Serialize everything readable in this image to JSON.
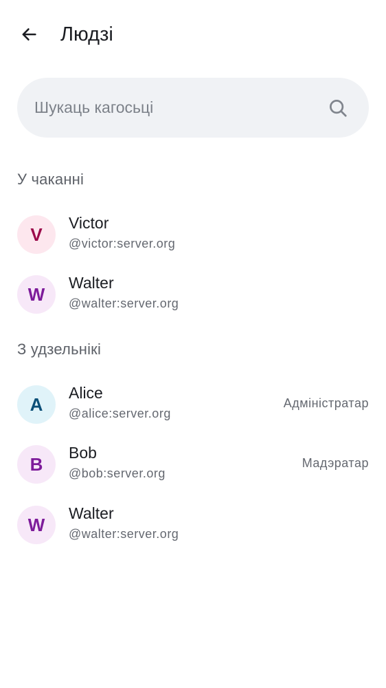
{
  "header": {
    "title": "Людзі",
    "back_icon": "arrow-left-icon"
  },
  "search": {
    "placeholder": "Шукаць кагосьці",
    "icon": "search-icon"
  },
  "sections": {
    "pending": {
      "title": "У чаканні",
      "members": [
        {
          "initial": "V",
          "name": "Victor",
          "id": "@victor:server.org",
          "avatar_bg": "#fde7ee",
          "avatar_fg": "#9b0a4a"
        },
        {
          "initial": "W",
          "name": "Walter",
          "id": "@walter:server.org",
          "avatar_bg": "#f7e8f8",
          "avatar_fg": "#7d1b9a"
        }
      ]
    },
    "joined": {
      "title": "З удзельнікі",
      "members": [
        {
          "initial": "A",
          "name": "Alice",
          "id": "@alice:server.org",
          "role": "Адміністратар",
          "avatar_bg": "#e0f3f9",
          "avatar_fg": "#0b4f78"
        },
        {
          "initial": "B",
          "name": "Bob",
          "id": "@bob:server.org",
          "role": "Мадэратар",
          "avatar_bg": "#f7e8f8",
          "avatar_fg": "#7d1b9a"
        },
        {
          "initial": "W",
          "name": "Walter",
          "id": "@walter:server.org",
          "avatar_bg": "#f7e8f8",
          "avatar_fg": "#7d1b9a"
        }
      ]
    }
  }
}
